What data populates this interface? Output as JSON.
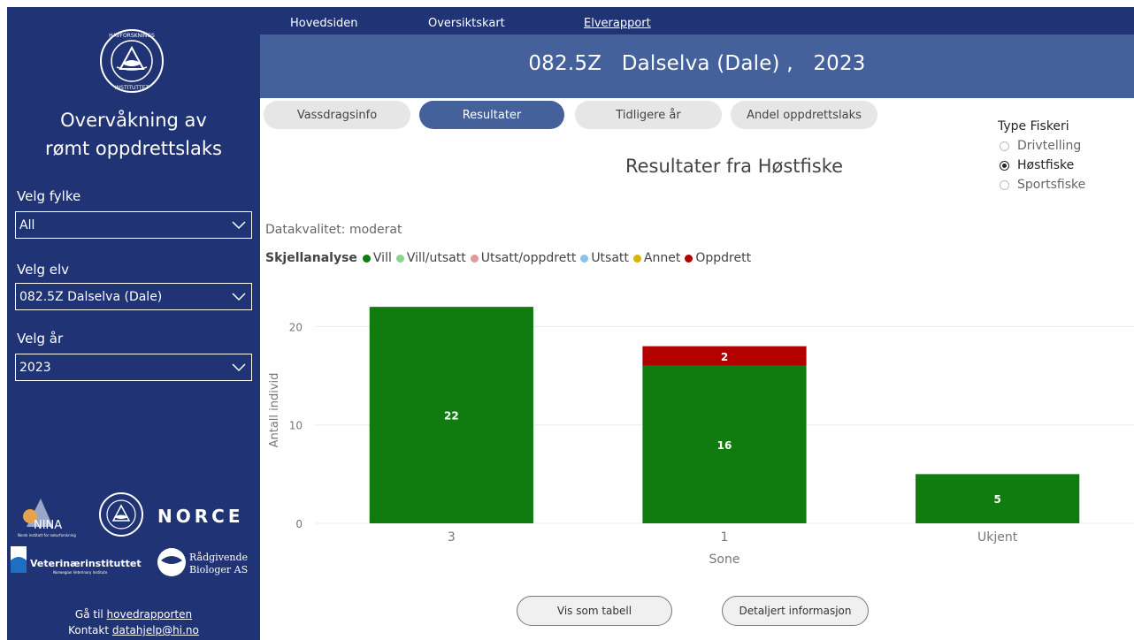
{
  "sidebar": {
    "title_line1": "Overvåkning av",
    "title_line2": "rømt oppdrettslaks",
    "filters": [
      {
        "label": "Velg fylke",
        "value": "All"
      },
      {
        "label": "Velg elv",
        "value": "082.5Z Dalselva (Dale)"
      },
      {
        "label": "Velg år",
        "value": "2023"
      }
    ],
    "partners": {
      "nina": "NINA",
      "nina_sub": "Norsk institutt for naturforskning",
      "norce": "NORCE",
      "vet": "Veterinærinstituttet",
      "vet_sub": "Norwegian Veterinary Institute",
      "rb_line1": "Rådgivende",
      "rb_line2": "Biologer AS"
    },
    "footer": {
      "goto_prefix": "Gå til ",
      "goto_link": "hovedrapporten",
      "contact_prefix": "Kontakt ",
      "contact_link": "datahjelp@hi.no"
    }
  },
  "nav": {
    "items": [
      "Hovedsiden",
      "Oversiktskart",
      "Elverapport"
    ],
    "active": "Elverapport"
  },
  "header": {
    "code": "082.5Z",
    "river": "Dalselva (Dale) ,",
    "year": "2023"
  },
  "tabs": [
    "Vassdragsinfo",
    "Resultater",
    "Tidligere år",
    "Andel oppdrettslaks"
  ],
  "active_tab": "Resultater",
  "type_fiskeri": {
    "title": "Type Fiskeri",
    "options": [
      "Drivtelling",
      "Høstfiske",
      "Sportsfiske"
    ],
    "selected": "Høstfiske"
  },
  "chart_title": "Resultater fra Høstfiske",
  "datakvalitet": "Datakvalitet: moderat",
  "legend": {
    "title": "Skjellanalyse",
    "items": [
      {
        "label": "Vill",
        "color": "#107c10"
      },
      {
        "label": "Vill/utsatt",
        "color": "#8fd18f"
      },
      {
        "label": "Utsatt/oppdrett",
        "color": "#e09a9a"
      },
      {
        "label": "Utsatt",
        "color": "#8fc0e8"
      },
      {
        "label": "Annet",
        "color": "#d9b300"
      },
      {
        "label": "Oppdrett",
        "color": "#b30000"
      }
    ]
  },
  "chart_data": {
    "type": "bar",
    "stacked": true,
    "categories": [
      "3",
      "1",
      "Ukjent"
    ],
    "series": [
      {
        "name": "Vill",
        "color": "#107c10",
        "values": [
          22,
          16,
          5
        ]
      },
      {
        "name": "Oppdrett",
        "color": "#b30000",
        "values": [
          0,
          2,
          0
        ]
      }
    ],
    "xlabel": "Sone",
    "ylabel": "Antall individ",
    "ylim": [
      0,
      23
    ],
    "yticks": [
      0,
      10,
      20
    ],
    "grid": true
  },
  "buttons": {
    "tabell": "Vis som tabell",
    "detaljert": "Detaljert informasjon"
  }
}
